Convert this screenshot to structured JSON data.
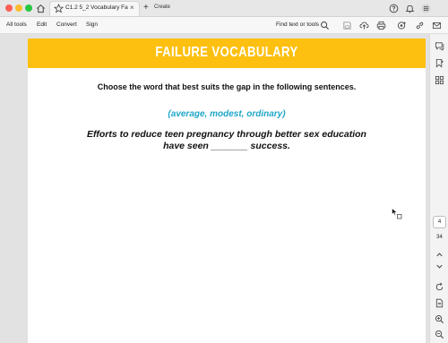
{
  "titlebar": {
    "tab_title": "C1.2 5_2 Vocabulary Fa...",
    "tab_close": "×",
    "create_label": "Create"
  },
  "menu": {
    "items": [
      "All tools",
      "Edit",
      "Convert",
      "Sign"
    ],
    "find_label": "Find text or tools"
  },
  "document": {
    "banner_title": "FAILURE VOCABULARY",
    "banner_color": "#fec010",
    "instruction": "Choose the word that best suits the gap in the following sentences.",
    "options": "(average, modest, ordinary)",
    "options_color": "#1ea6c8",
    "sentence_line1": "Efforts to reduce teen pregnancy through better sex education",
    "sentence_line2": "have seen _______ success."
  },
  "page_nav": {
    "current": "4",
    "total": "34"
  },
  "icons": {
    "titlebar_right": [
      "help-icon",
      "bell-icon",
      "apps-grid-icon"
    ],
    "toolbar_right": [
      "search-icon",
      "save-icon",
      "upload-icon",
      "print-icon",
      "ai-assistant-icon",
      "link-icon",
      "mail-icon"
    ],
    "sidebar": [
      "comment-icon",
      "bookmark-icon",
      "thumbnails-icon",
      "chevron-up-icon",
      "chevron-down-icon",
      "rotate-icon",
      "document-info-icon",
      "zoom-in-icon",
      "zoom-out-icon"
    ]
  }
}
